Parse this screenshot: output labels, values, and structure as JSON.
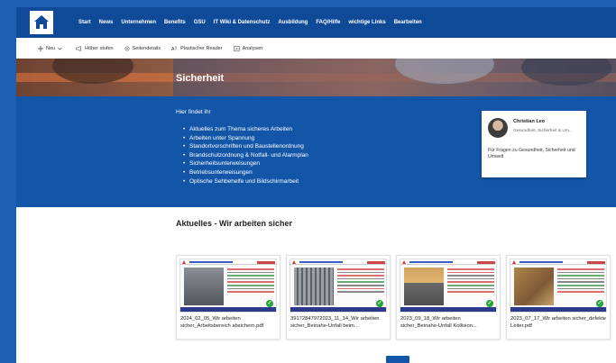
{
  "nav": {
    "links": [
      "Start",
      "News",
      "Unternehmen",
      "Benefits",
      "GSU",
      "IT Wiki & Datenschutz",
      "Ausbildung",
      "FAQ/Hilfe",
      "wichtige Links",
      "Bearbeiten"
    ]
  },
  "cmdbar": {
    "new_label": "Neu",
    "promote_label": "Höher stufen",
    "page_details_label": "Seitendetails",
    "reader_label": "Plastischer Reader",
    "analytics_label": "Analysen"
  },
  "hero": {
    "title": "Sicherheit"
  },
  "info": {
    "intro": "Hier findet ihr",
    "items": [
      "Aktuelles zum Thema sicheres Arbeiten",
      "Arbeiten unter Spannung",
      "Standortvorschriften und Baustellenordnung",
      "Brandschutzordnung & Notfall- und Alarmplan",
      "Sicherheitsunterweisungen",
      "Betriebsunterweisungen",
      "Optische Sehbehelfe und Bildschirmarbeit"
    ]
  },
  "contact": {
    "name": "Christian Leo",
    "role": "Gesundheit, Sicherheit & Um...",
    "note": "Für Fragen zu Gesundheit, Sicherheit und Umwelt"
  },
  "news": {
    "title": "Aktuelles - Wir arbeiten sicher",
    "cards": [
      {
        "title": "2024_02_05_Wir arbeiten sicher_Arbeitsbereich absichern.pdf"
      },
      {
        "title": "39172847972023_11_14_Wir arbeiten sicher_Beinahe-Unfall beim..."
      },
      {
        "title": "2023_09_18_Wir arbeiten sicher_Beinahe-Unfall Kollision..."
      },
      {
        "title": "2023_07_17_Wir arbeiten sicher_defekte Leiter.pdf"
      }
    ]
  },
  "colors": {
    "accent": "#1356a8",
    "nav": "#0f4a99",
    "check": "#26a336"
  }
}
